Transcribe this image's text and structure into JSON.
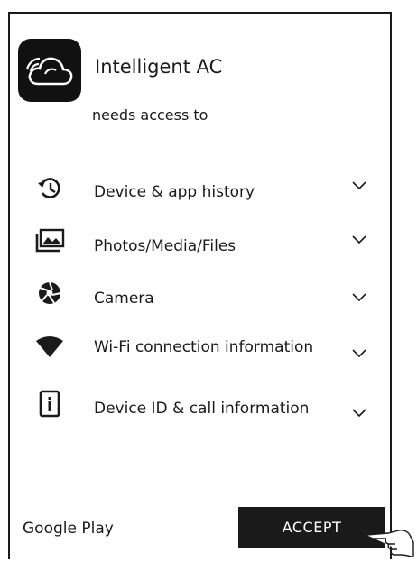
{
  "app": {
    "name": "Intelligent AC",
    "subtitle": "needs access to"
  },
  "permissions": [
    {
      "id": "device-app-history",
      "label": "Device & app history",
      "icon": "history-icon"
    },
    {
      "id": "photos-media-files",
      "label": "Photos/Media/Files",
      "icon": "photo-icon"
    },
    {
      "id": "camera",
      "label": "Camera",
      "icon": "camera-shutter-icon"
    },
    {
      "id": "wifi",
      "label": "Wi-Fi connection information",
      "icon": "wifi-icon"
    },
    {
      "id": "device-id",
      "label": "Device ID & call information",
      "icon": "phone-info-icon"
    }
  ],
  "footer": {
    "store": "Google Play",
    "accept_label": "ACCEPT"
  },
  "colors": {
    "ink": "#1a1a1a",
    "button_bg": "#1a1a1a",
    "button_text": "#ffffff",
    "background": "#ffffff"
  }
}
